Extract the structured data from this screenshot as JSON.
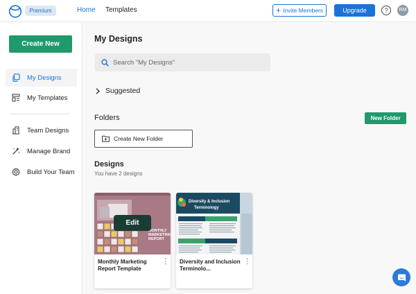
{
  "header": {
    "badge": "Premium",
    "nav": {
      "home": "Home",
      "templates": "Templates"
    },
    "invite_label": "Invite Members",
    "upgrade_label": "Upgrade",
    "help_label": "?",
    "avatar_initials": "RM",
    "accent_color": "#1a73d9"
  },
  "sidebar": {
    "create_label": "Create New",
    "items": [
      {
        "label": "My Designs",
        "icon": "copy-icon",
        "active": true
      },
      {
        "label": "My Templates",
        "icon": "template-icon",
        "active": false
      },
      {
        "label": "Team Designs",
        "icon": "building-icon",
        "active": false
      },
      {
        "label": "Manage Brand",
        "icon": "magic-wand-icon",
        "active": false
      },
      {
        "label": "Build Your Team",
        "icon": "gear-icon",
        "active": false
      }
    ],
    "brand_color": "#1f9a6a"
  },
  "main": {
    "title": "My Designs",
    "search_placeholder": "Search \"My Designs\"",
    "suggested_label": "Suggested",
    "folders_title": "Folders",
    "new_folder_label": "New Folder",
    "create_folder_label": "Create New Folder",
    "designs_title": "Designs",
    "designs_count": "You have 2 designs",
    "designs": [
      {
        "name": "Monthly Marketing Report Template",
        "thumb_title": "MONTHLY MARKETING REPORT",
        "edit_label": "Edit"
      },
      {
        "name": "Diversity and Inclusion Terminolo...",
        "thumb_title": "Diversity & Inclusion Terminology",
        "thumb_tags": [
          "Ally",
          "Unconscious Bias",
          "Equity",
          "Inclusion"
        ]
      }
    ]
  }
}
